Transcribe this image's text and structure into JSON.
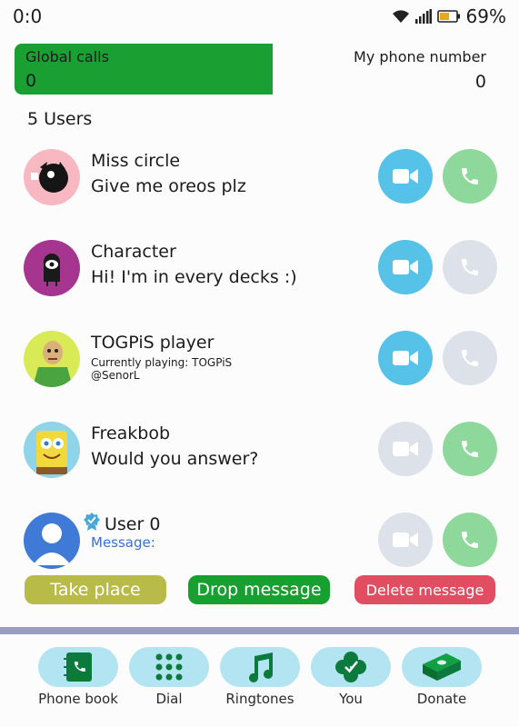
{
  "status": {
    "time": "0:0",
    "battery": "69%"
  },
  "header": {
    "global_calls_label": "Global calls",
    "global_calls_value": "0",
    "phone_label": "My phone number",
    "phone_value": "0"
  },
  "users_count": "5 Users",
  "users": [
    {
      "name": "Miss circle",
      "message": "Give me oreos plz",
      "video": "available",
      "call": "available"
    },
    {
      "name": "Character",
      "message": "Hi! I'm in every decks :)",
      "video": "available",
      "call": "disabled"
    },
    {
      "name": "TOGPiS player",
      "message": "Currently playing: TOGPiS\n@SenorL",
      "video": "available",
      "call": "disabled"
    },
    {
      "name": "Freakbob",
      "message": "Would you answer?",
      "video": "disabled",
      "call": "available"
    },
    {
      "name": "User 0",
      "message": "Message:",
      "video": "disabled",
      "call": "available"
    }
  ],
  "actions": {
    "take": "Take place",
    "drop": "Drop message",
    "delete": "Delete message"
  },
  "nav": [
    {
      "label": "Phone book",
      "icon": "phone-book-icon"
    },
    {
      "label": "Dial",
      "icon": "dial-pad-icon"
    },
    {
      "label": "Ringtones",
      "icon": "music-note-icon"
    },
    {
      "label": "You",
      "icon": "clover-check-icon"
    },
    {
      "label": "Donate",
      "icon": "money-icon"
    }
  ],
  "colors": {
    "accent_green": "#1a9f33",
    "video_blue": "#56c2e7",
    "call_green": "#8fd89b",
    "disabled_grey": "#dde1ea",
    "delete_red": "#e14e62",
    "take_olive": "#b8bb48",
    "nav_pill": "#b3e4f1"
  }
}
